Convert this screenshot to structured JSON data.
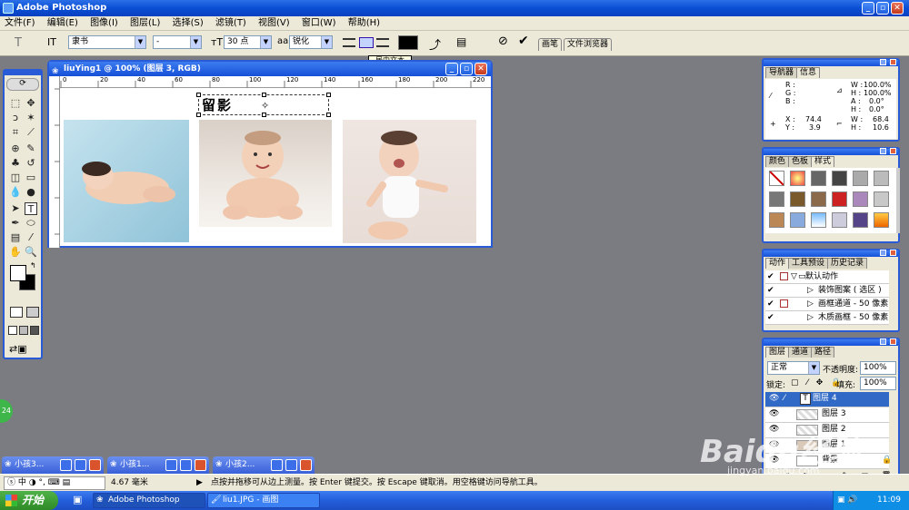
{
  "app": {
    "title": "Adobe Photoshop"
  },
  "menu": [
    "文件(F)",
    "编辑(E)",
    "图像(I)",
    "图层(L)",
    "选择(S)",
    "滤镜(T)",
    "视图(V)",
    "窗口(W)",
    "帮助(H)"
  ],
  "options": {
    "font_family": "隶书",
    "font_style": "-",
    "font_size": "30 点",
    "antialias": "锐化",
    "tooltip": "居中文本",
    "tab_brush": "画笔",
    "tab_browser": "文件浏览器"
  },
  "document": {
    "title": "liuYing1 @ 100% (图层 3, RGB)",
    "text_layer_content": "留影",
    "ruler_ticks": [
      "0",
      "20",
      "40",
      "60",
      "80",
      "100",
      "120",
      "140",
      "160",
      "180",
      "200",
      "220"
    ]
  },
  "navigator": {
    "tabs": [
      "导航器",
      "信息"
    ],
    "r": "R :",
    "g": "G :",
    "b": "B :",
    "w_pct": "100.0%",
    "h_pct": "100.0%",
    "a": "A :",
    "a_val": "0.0°",
    "hh": "H :",
    "hh_val": "0.0°",
    "x_label": "X :",
    "x_val": "74.4",
    "y_label": "Y :",
    "y_val": "3.9",
    "w_label": "W :",
    "w_val": "68.4",
    "h_label": "H :",
    "h_val": "10.6",
    "w_lbl_pct": "W :",
    "h_lbl_pct": "H :"
  },
  "color_panel": {
    "tabs": [
      "颜色",
      "色板",
      "样式"
    ]
  },
  "actions_panel": {
    "tabs": [
      "动作",
      "工具预设",
      "历史记录"
    ],
    "items": [
      "默认动作",
      "装饰图案 ( 选区 )",
      "画框通道 - 50 像素",
      "木质画框 - 50 像素"
    ]
  },
  "layers_panel": {
    "tabs": [
      "图层",
      "通道",
      "路径"
    ],
    "blend_mode": "正常",
    "opacity_label": "不透明度:",
    "opacity_value": "100%",
    "lock_label": "锁定:",
    "fill_label": "填充:",
    "fill_value": "100%",
    "layers": [
      "图层 4",
      "图层 3",
      "图层 2",
      "图层 1",
      "背景"
    ]
  },
  "minimized_windows": [
    "小孩3...",
    "小孩1...",
    "小孩2..."
  ],
  "statusbar": {
    "ime": "中",
    "size": "4.67 毫米",
    "hint": "点按并拖移可从边上测量。按 Enter 键提交。按 Escape 键取消。用空格键访问导航工具。"
  },
  "taskbar": {
    "start": "开始",
    "tasks": [
      "Adobe Photoshop",
      "liu1.JPG - 画图"
    ],
    "clock": "11:09"
  },
  "badge": "24",
  "watermark": "Baidu经验",
  "watermark_url": "jingyan.baidu.com"
}
